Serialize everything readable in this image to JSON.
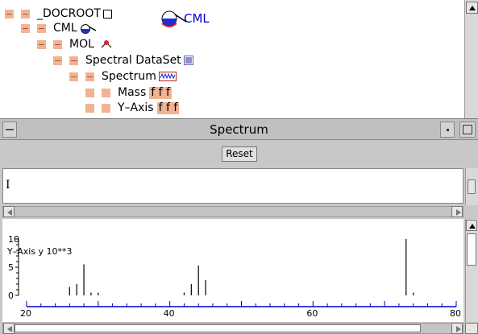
{
  "tree": {
    "nodes": [
      {
        "label": "_DOCROOT",
        "indent": 0,
        "icon": "empty-box-icon"
      },
      {
        "label": "CML",
        "indent": 1,
        "icon": "cml-flask-icon"
      },
      {
        "label": "MOL",
        "indent": 2,
        "icon": "molecule-icon"
      },
      {
        "label": "Spectral DataSet",
        "indent": 3,
        "icon": "dataset-icon"
      },
      {
        "label": "Spectrum",
        "indent": 4,
        "icon": "spectrum-icon"
      },
      {
        "label": "Mass",
        "indent": 5,
        "suffix": "f f f"
      },
      {
        "label": "Y–Axis",
        "indent": 5,
        "suffix": "f f f"
      }
    ],
    "badge_label": "CML"
  },
  "frame": {
    "title": "Spectrum",
    "reset_label": "Reset"
  },
  "textarea": {
    "cursor": "I"
  },
  "chart_data": {
    "type": "bar",
    "ylabel": "Y–Axis y 10**3",
    "yticks": [
      "10",
      "5",
      "0"
    ],
    "ylim": [
      0,
      10
    ],
    "xlim": [
      20,
      80
    ],
    "xticks": [
      "20",
      "40",
      "60",
      "80"
    ],
    "x": [
      26,
      27,
      28,
      29,
      30,
      42,
      43,
      44,
      45,
      73,
      74
    ],
    "values": [
      1.5,
      2,
      5.5,
      0.5,
      0.5,
      0.5,
      2,
      5.3,
      2.7,
      10,
      0.5
    ],
    "color": "#000000",
    "axis_color": "#0000cc"
  },
  "colors": {
    "node_square": "#f2b393",
    "badge_text": "#0000cc",
    "tree_bg": "#ffffff"
  }
}
